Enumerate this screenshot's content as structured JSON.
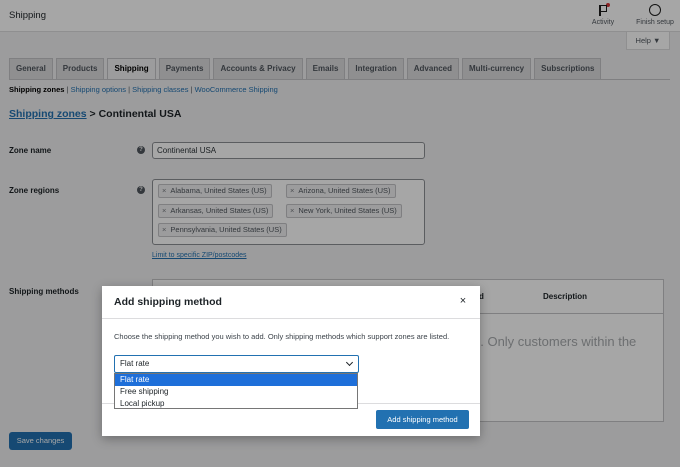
{
  "header": {
    "title": "Shipping",
    "activity_label": "Activity",
    "finish_label": "Finish setup",
    "help_label": "Help ▼"
  },
  "tabs": [
    {
      "label": "General"
    },
    {
      "label": "Products"
    },
    {
      "label": "Shipping"
    },
    {
      "label": "Payments"
    },
    {
      "label": "Accounts & Privacy"
    },
    {
      "label": "Emails"
    },
    {
      "label": "Integration"
    },
    {
      "label": "Advanced"
    },
    {
      "label": "Multi-currency"
    },
    {
      "label": "Subscriptions"
    }
  ],
  "subnav": {
    "zones": "Shipping zones",
    "options": "Shipping options",
    "classes": "Shipping classes",
    "woo": "WooCommerce Shipping",
    "sep": "|"
  },
  "breadcrumb": {
    "link": "Shipping zones",
    "separator": ">",
    "current": "Continental USA"
  },
  "form": {
    "zone_name_label": "Zone name",
    "zone_name_value": "Continental USA",
    "zone_regions_label": "Zone regions",
    "regions": [
      "Alabama, United States (US)",
      "Arizona, United States (US)",
      "Arkansas, United States (US)",
      "New York, United States (US)",
      "Pennsylvania, United States (US)"
    ],
    "limit_link": "Limit to specific ZIP/postcodes",
    "shipping_methods_label": "Shipping methods",
    "col_enabled_partial": "d",
    "col_description": "Description",
    "blank_text": "e. Only customers within the",
    "save_label": "Save changes",
    "help_glyph": "?",
    "remove_glyph": "×"
  },
  "modal": {
    "title": "Add shipping method",
    "close_glyph": "×",
    "description": "Choose the shipping method you wish to add. Only shipping methods which support zones are listed.",
    "selected": "Flat rate",
    "options": [
      "Flat rate",
      "Free shipping",
      "Local pickup"
    ],
    "button_label": "Add shipping method"
  },
  "colors": {
    "accent": "#2271b1",
    "selected_option": "#1e6fd9",
    "notification_dot": "#d63638"
  }
}
